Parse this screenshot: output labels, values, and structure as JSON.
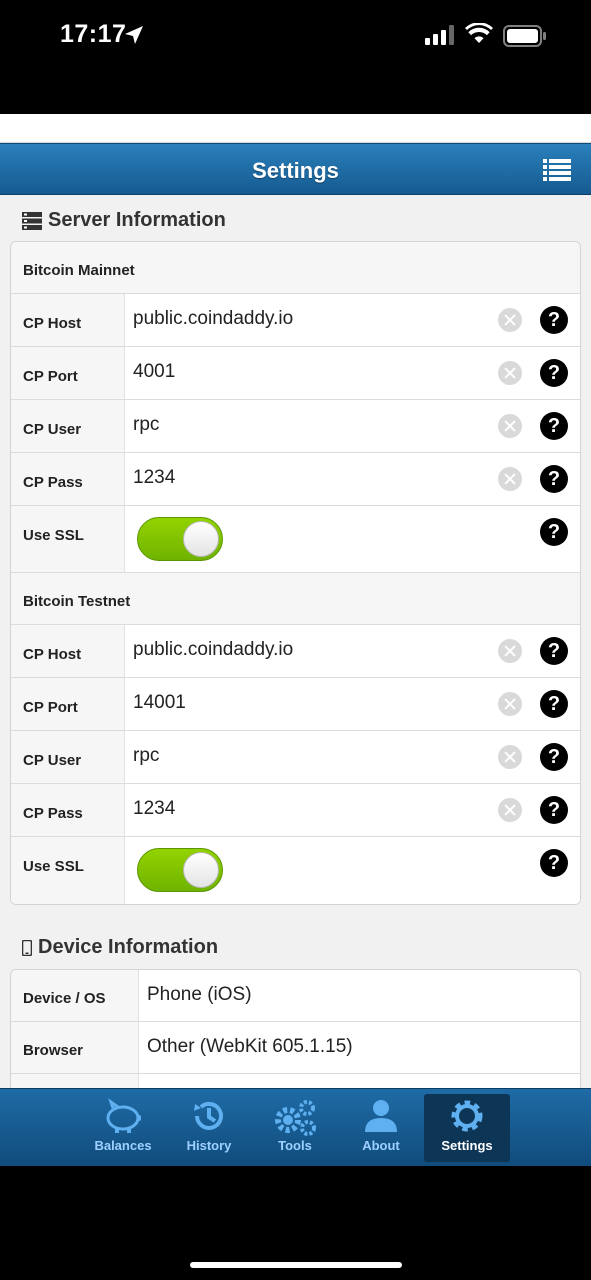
{
  "status_bar": {
    "time": "17:17"
  },
  "header": {
    "title": "Settings"
  },
  "server_section": {
    "title": "Server Information",
    "groups": [
      {
        "name": "Bitcoin Mainnet",
        "rows": [
          {
            "label": "CP Host",
            "value": "public.coindaddy.io"
          },
          {
            "label": "CP Port",
            "value": "4001"
          },
          {
            "label": "CP User",
            "value": "rpc"
          },
          {
            "label": "CP Pass",
            "value": "1234"
          }
        ],
        "ssl_label": "Use SSL",
        "ssl_on": true
      },
      {
        "name": "Bitcoin Testnet",
        "rows": [
          {
            "label": "CP Host",
            "value": "public.coindaddy.io"
          },
          {
            "label": "CP Port",
            "value": "14001"
          },
          {
            "label": "CP User",
            "value": "rpc"
          },
          {
            "label": "CP Pass",
            "value": "1234"
          }
        ],
        "ssl_label": "Use SSL",
        "ssl_on": true
      }
    ]
  },
  "device_section": {
    "title": "Device Information",
    "rows": [
      {
        "label": "Device / OS",
        "value": "Phone (iOS)"
      },
      {
        "label": "Browser",
        "value": "Other (WebKit 605.1.15)"
      }
    ]
  },
  "tabbar": {
    "tabs": [
      {
        "label": "Balances",
        "icon": "piggy-bank-icon"
      },
      {
        "label": "History",
        "icon": "history-icon"
      },
      {
        "label": "Tools",
        "icon": "gears-icon"
      },
      {
        "label": "About",
        "icon": "user-icon"
      },
      {
        "label": "Settings",
        "icon": "gear-icon"
      }
    ],
    "active": "Settings"
  },
  "colors": {
    "header": "#1f6ba6",
    "toggle_on": "#7cc300",
    "active_tab": "#0d3556"
  }
}
